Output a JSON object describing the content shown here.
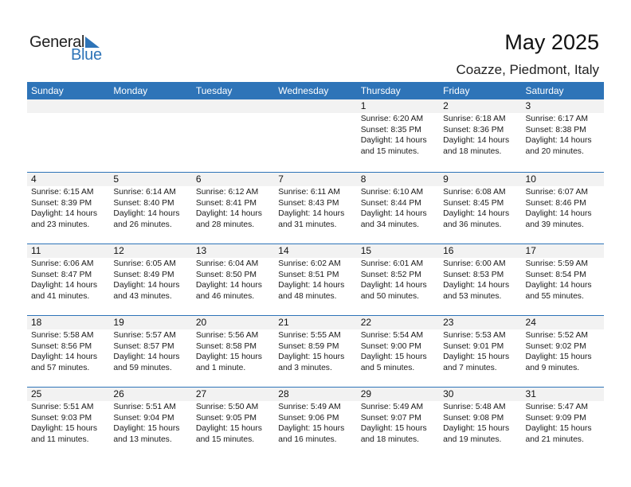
{
  "logo": {
    "word1": "General",
    "word2": "Blue"
  },
  "header": {
    "title": "May 2025",
    "location": "Coazze, Piedmont, Italy"
  },
  "colors": {
    "accent": "#2e74b8",
    "day_bg": "#f2f2f2"
  },
  "weekdays": [
    "Sunday",
    "Monday",
    "Tuesday",
    "Wednesday",
    "Thursday",
    "Friday",
    "Saturday"
  ],
  "weeks": [
    [
      {
        "day": "",
        "sunrise": "",
        "sunset": "",
        "daylight1": "",
        "daylight2": ""
      },
      {
        "day": "",
        "sunrise": "",
        "sunset": "",
        "daylight1": "",
        "daylight2": ""
      },
      {
        "day": "",
        "sunrise": "",
        "sunset": "",
        "daylight1": "",
        "daylight2": ""
      },
      {
        "day": "",
        "sunrise": "",
        "sunset": "",
        "daylight1": "",
        "daylight2": ""
      },
      {
        "day": "1",
        "sunrise": "Sunrise: 6:20 AM",
        "sunset": "Sunset: 8:35 PM",
        "daylight1": "Daylight: 14 hours",
        "daylight2": "and 15 minutes."
      },
      {
        "day": "2",
        "sunrise": "Sunrise: 6:18 AM",
        "sunset": "Sunset: 8:36 PM",
        "daylight1": "Daylight: 14 hours",
        "daylight2": "and 18 minutes."
      },
      {
        "day": "3",
        "sunrise": "Sunrise: 6:17 AM",
        "sunset": "Sunset: 8:38 PM",
        "daylight1": "Daylight: 14 hours",
        "daylight2": "and 20 minutes."
      }
    ],
    [
      {
        "day": "4",
        "sunrise": "Sunrise: 6:15 AM",
        "sunset": "Sunset: 8:39 PM",
        "daylight1": "Daylight: 14 hours",
        "daylight2": "and 23 minutes."
      },
      {
        "day": "5",
        "sunrise": "Sunrise: 6:14 AM",
        "sunset": "Sunset: 8:40 PM",
        "daylight1": "Daylight: 14 hours",
        "daylight2": "and 26 minutes."
      },
      {
        "day": "6",
        "sunrise": "Sunrise: 6:12 AM",
        "sunset": "Sunset: 8:41 PM",
        "daylight1": "Daylight: 14 hours",
        "daylight2": "and 28 minutes."
      },
      {
        "day": "7",
        "sunrise": "Sunrise: 6:11 AM",
        "sunset": "Sunset: 8:43 PM",
        "daylight1": "Daylight: 14 hours",
        "daylight2": "and 31 minutes."
      },
      {
        "day": "8",
        "sunrise": "Sunrise: 6:10 AM",
        "sunset": "Sunset: 8:44 PM",
        "daylight1": "Daylight: 14 hours",
        "daylight2": "and 34 minutes."
      },
      {
        "day": "9",
        "sunrise": "Sunrise: 6:08 AM",
        "sunset": "Sunset: 8:45 PM",
        "daylight1": "Daylight: 14 hours",
        "daylight2": "and 36 minutes."
      },
      {
        "day": "10",
        "sunrise": "Sunrise: 6:07 AM",
        "sunset": "Sunset: 8:46 PM",
        "daylight1": "Daylight: 14 hours",
        "daylight2": "and 39 minutes."
      }
    ],
    [
      {
        "day": "11",
        "sunrise": "Sunrise: 6:06 AM",
        "sunset": "Sunset: 8:47 PM",
        "daylight1": "Daylight: 14 hours",
        "daylight2": "and 41 minutes."
      },
      {
        "day": "12",
        "sunrise": "Sunrise: 6:05 AM",
        "sunset": "Sunset: 8:49 PM",
        "daylight1": "Daylight: 14 hours",
        "daylight2": "and 43 minutes."
      },
      {
        "day": "13",
        "sunrise": "Sunrise: 6:04 AM",
        "sunset": "Sunset: 8:50 PM",
        "daylight1": "Daylight: 14 hours",
        "daylight2": "and 46 minutes."
      },
      {
        "day": "14",
        "sunrise": "Sunrise: 6:02 AM",
        "sunset": "Sunset: 8:51 PM",
        "daylight1": "Daylight: 14 hours",
        "daylight2": "and 48 minutes."
      },
      {
        "day": "15",
        "sunrise": "Sunrise: 6:01 AM",
        "sunset": "Sunset: 8:52 PM",
        "daylight1": "Daylight: 14 hours",
        "daylight2": "and 50 minutes."
      },
      {
        "day": "16",
        "sunrise": "Sunrise: 6:00 AM",
        "sunset": "Sunset: 8:53 PM",
        "daylight1": "Daylight: 14 hours",
        "daylight2": "and 53 minutes."
      },
      {
        "day": "17",
        "sunrise": "Sunrise: 5:59 AM",
        "sunset": "Sunset: 8:54 PM",
        "daylight1": "Daylight: 14 hours",
        "daylight2": "and 55 minutes."
      }
    ],
    [
      {
        "day": "18",
        "sunrise": "Sunrise: 5:58 AM",
        "sunset": "Sunset: 8:56 PM",
        "daylight1": "Daylight: 14 hours",
        "daylight2": "and 57 minutes."
      },
      {
        "day": "19",
        "sunrise": "Sunrise: 5:57 AM",
        "sunset": "Sunset: 8:57 PM",
        "daylight1": "Daylight: 14 hours",
        "daylight2": "and 59 minutes."
      },
      {
        "day": "20",
        "sunrise": "Sunrise: 5:56 AM",
        "sunset": "Sunset: 8:58 PM",
        "daylight1": "Daylight: 15 hours",
        "daylight2": "and 1 minute."
      },
      {
        "day": "21",
        "sunrise": "Sunrise: 5:55 AM",
        "sunset": "Sunset: 8:59 PM",
        "daylight1": "Daylight: 15 hours",
        "daylight2": "and 3 minutes."
      },
      {
        "day": "22",
        "sunrise": "Sunrise: 5:54 AM",
        "sunset": "Sunset: 9:00 PM",
        "daylight1": "Daylight: 15 hours",
        "daylight2": "and 5 minutes."
      },
      {
        "day": "23",
        "sunrise": "Sunrise: 5:53 AM",
        "sunset": "Sunset: 9:01 PM",
        "daylight1": "Daylight: 15 hours",
        "daylight2": "and 7 minutes."
      },
      {
        "day": "24",
        "sunrise": "Sunrise: 5:52 AM",
        "sunset": "Sunset: 9:02 PM",
        "daylight1": "Daylight: 15 hours",
        "daylight2": "and 9 minutes."
      }
    ],
    [
      {
        "day": "25",
        "sunrise": "Sunrise: 5:51 AM",
        "sunset": "Sunset: 9:03 PM",
        "daylight1": "Daylight: 15 hours",
        "daylight2": "and 11 minutes."
      },
      {
        "day": "26",
        "sunrise": "Sunrise: 5:51 AM",
        "sunset": "Sunset: 9:04 PM",
        "daylight1": "Daylight: 15 hours",
        "daylight2": "and 13 minutes."
      },
      {
        "day": "27",
        "sunrise": "Sunrise: 5:50 AM",
        "sunset": "Sunset: 9:05 PM",
        "daylight1": "Daylight: 15 hours",
        "daylight2": "and 15 minutes."
      },
      {
        "day": "28",
        "sunrise": "Sunrise: 5:49 AM",
        "sunset": "Sunset: 9:06 PM",
        "daylight1": "Daylight: 15 hours",
        "daylight2": "and 16 minutes."
      },
      {
        "day": "29",
        "sunrise": "Sunrise: 5:49 AM",
        "sunset": "Sunset: 9:07 PM",
        "daylight1": "Daylight: 15 hours",
        "daylight2": "and 18 minutes."
      },
      {
        "day": "30",
        "sunrise": "Sunrise: 5:48 AM",
        "sunset": "Sunset: 9:08 PM",
        "daylight1": "Daylight: 15 hours",
        "daylight2": "and 19 minutes."
      },
      {
        "day": "31",
        "sunrise": "Sunrise: 5:47 AM",
        "sunset": "Sunset: 9:09 PM",
        "daylight1": "Daylight: 15 hours",
        "daylight2": "and 21 minutes."
      }
    ]
  ]
}
